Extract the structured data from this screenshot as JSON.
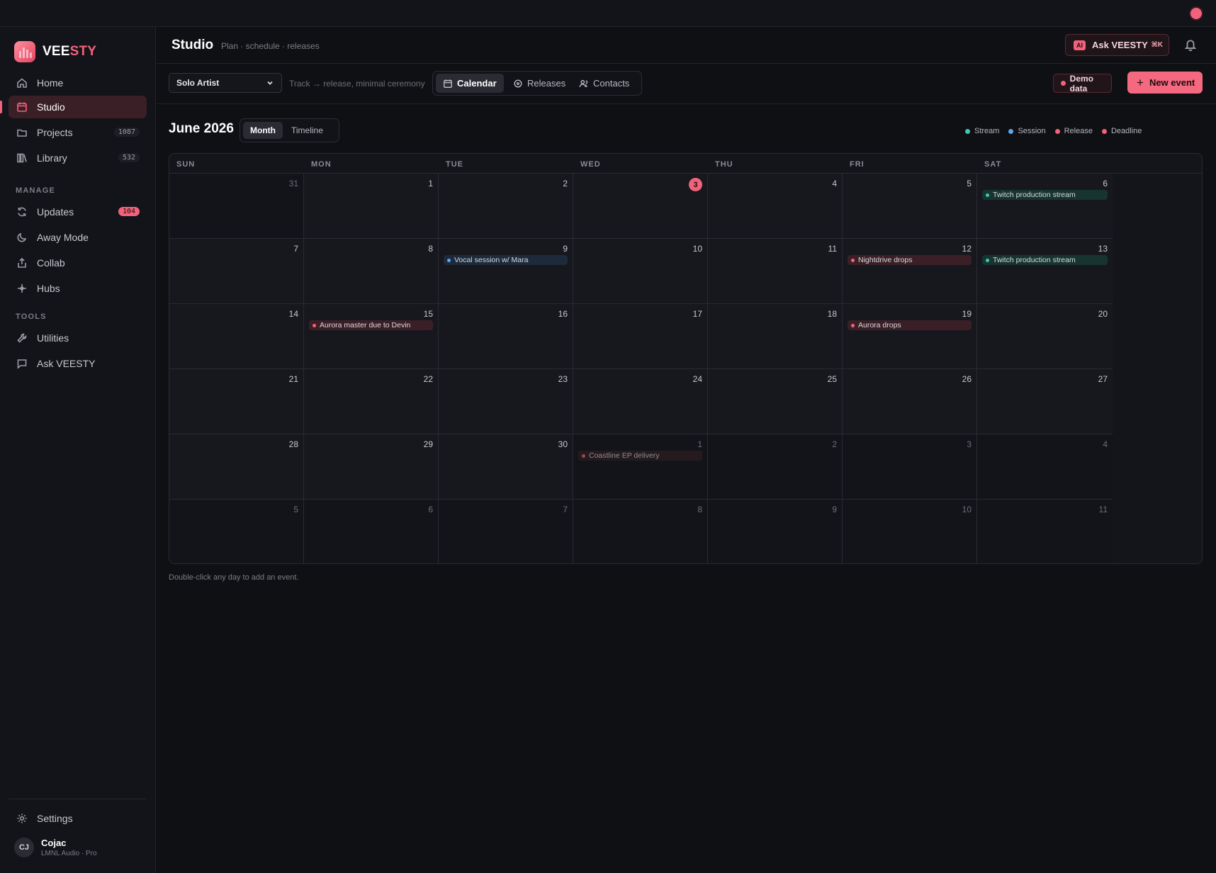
{
  "brand": {
    "name_part1": "VEE",
    "name_part2": "STY"
  },
  "sidebar": {
    "items": [
      {
        "label": "Home",
        "icon": "home-icon"
      },
      {
        "label": "Studio",
        "icon": "calendar-icon",
        "active": true
      },
      {
        "label": "Projects",
        "icon": "folder-icon",
        "badge": "1087"
      },
      {
        "label": "Library",
        "icon": "library-icon",
        "badge": "532"
      }
    ],
    "manage_label": "MANAGE",
    "manage_items": [
      {
        "label": "Updates",
        "icon": "refresh-icon",
        "badge": "104"
      },
      {
        "label": "Away Mode",
        "icon": "moon-icon"
      },
      {
        "label": "Collab",
        "icon": "share-icon"
      },
      {
        "label": "Hubs",
        "icon": "sparkle-icon"
      }
    ],
    "tools_label": "TOOLS",
    "tools_items": [
      {
        "label": "Utilities",
        "icon": "wrench-icon"
      },
      {
        "label": "Ask VEESTY",
        "icon": "chat-icon"
      }
    ],
    "settings_label": "Settings",
    "user": {
      "initials": "CJ",
      "name": "Cojac",
      "subtitle": "LMNL Audio · Pro"
    }
  },
  "header": {
    "title": "Studio",
    "subtitle": "Plan · schedule · releases",
    "ask": {
      "tag": "AI",
      "label": "Ask VEESTY",
      "shortcut": "⌘K"
    }
  },
  "toolbar": {
    "artist_select": "Solo Artist",
    "hint": "Track → release, minimal ceremony",
    "tabs": [
      {
        "label": "Calendar",
        "active": true
      },
      {
        "label": "Releases"
      },
      {
        "label": "Contacts"
      }
    ],
    "demo_label": "Demo data",
    "new_event_label": "New event"
  },
  "calendar": {
    "month_title": "June 2026",
    "views": [
      "Month",
      "Timeline"
    ],
    "active_view": "Month",
    "legend": [
      {
        "label": "Stream",
        "color": "#3ec9b4"
      },
      {
        "label": "Session",
        "color": "#5ea7e8"
      },
      {
        "label": "Release",
        "color": "#f2627a"
      },
      {
        "label": "Deadline",
        "color": "#f2627a"
      }
    ],
    "weekdays": [
      "SUN",
      "MON",
      "TUE",
      "WED",
      "THU",
      "FRI",
      "SAT"
    ],
    "days": [
      {
        "n": "31",
        "other": true
      },
      {
        "n": "1"
      },
      {
        "n": "2"
      },
      {
        "n": "3",
        "today": true
      },
      {
        "n": "4"
      },
      {
        "n": "5"
      },
      {
        "n": "6",
        "event": {
          "label": "Twitch production stream",
          "type": "stream"
        }
      },
      {
        "n": "7"
      },
      {
        "n": "8"
      },
      {
        "n": "9",
        "event": {
          "label": "Vocal session w/ Mara",
          "type": "session"
        }
      },
      {
        "n": "10"
      },
      {
        "n": "11"
      },
      {
        "n": "12",
        "event": {
          "label": "Nightdrive drops",
          "type": "release"
        }
      },
      {
        "n": "13",
        "event": {
          "label": "Twitch production stream",
          "type": "stream"
        }
      },
      {
        "n": "14"
      },
      {
        "n": "15",
        "event": {
          "label": "Aurora master due to Devin",
          "type": "deadline"
        }
      },
      {
        "n": "16"
      },
      {
        "n": "17"
      },
      {
        "n": "18"
      },
      {
        "n": "19",
        "event": {
          "label": "Aurora drops",
          "type": "release"
        }
      },
      {
        "n": "20"
      },
      {
        "n": "21"
      },
      {
        "n": "22"
      },
      {
        "n": "23"
      },
      {
        "n": "24"
      },
      {
        "n": "25"
      },
      {
        "n": "26"
      },
      {
        "n": "27"
      },
      {
        "n": "28"
      },
      {
        "n": "29"
      },
      {
        "n": "30"
      },
      {
        "n": "1",
        "other": true,
        "event": {
          "label": "Coastline EP delivery",
          "type": "muted"
        }
      },
      {
        "n": "2",
        "other": true
      },
      {
        "n": "3",
        "other": true
      },
      {
        "n": "4",
        "other": true
      },
      {
        "n": "5",
        "other": true
      },
      {
        "n": "6",
        "other": true
      },
      {
        "n": "7",
        "other": true
      },
      {
        "n": "8",
        "other": true
      },
      {
        "n": "9",
        "other": true
      },
      {
        "n": "10",
        "other": true
      },
      {
        "n": "11",
        "other": true
      }
    ],
    "footnote": "Double-click any day to add an event."
  }
}
